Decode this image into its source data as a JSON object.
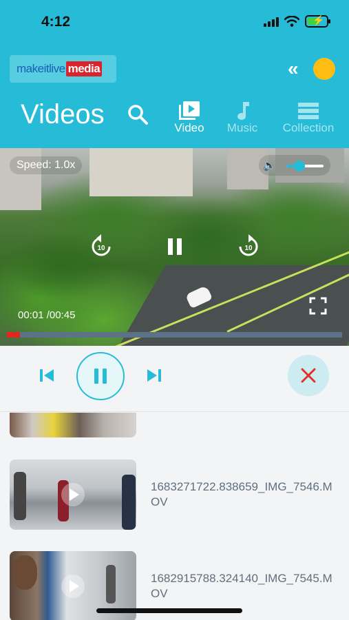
{
  "status_bar": {
    "time": "4:12"
  },
  "header": {
    "logo": {
      "part1": "makeitlive",
      "part2": "media"
    },
    "title": "Videos",
    "tabs": [
      {
        "label": "Video",
        "active": true
      },
      {
        "label": "Music",
        "active": false
      },
      {
        "label": "Collection",
        "active": false
      }
    ]
  },
  "player": {
    "speed_label": "Speed: 1.0x",
    "elapsed": "00:01 /00:45",
    "progress": 0.04,
    "volume_level": 0.35,
    "state": "playing"
  },
  "playlist": {
    "items": [
      {
        "name": ""
      },
      {
        "name": "1683271722.838659_IMG_7546.MOV"
      },
      {
        "name": "1682915788.324140_IMG_7545.MOV"
      }
    ]
  },
  "colors": {
    "accent": "#26bcd7",
    "close_red": "#e0302a",
    "progress_red": "#e0261f",
    "brand_orange": "#ffbd14"
  }
}
